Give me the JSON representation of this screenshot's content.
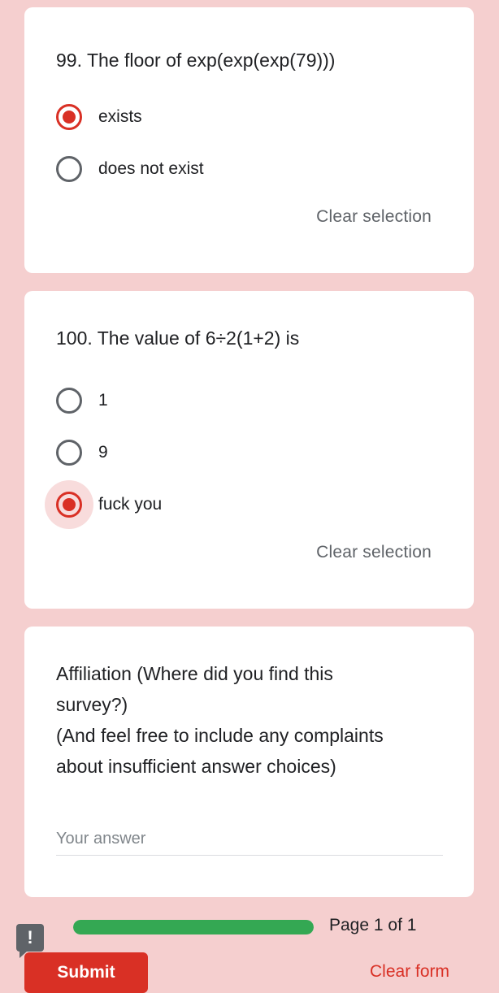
{
  "questions": [
    {
      "title": "99.  The floor of exp(exp(exp(79)))",
      "options": [
        {
          "label": "exists",
          "selected": true
        },
        {
          "label": "does not exist",
          "selected": false
        }
      ],
      "clear_label": "Clear selection"
    },
    {
      "title": "100.  The value of 6÷2(1+2) is",
      "options": [
        {
          "label": "1",
          "selected": false
        },
        {
          "label": "9",
          "selected": false
        },
        {
          "label": "fuck you",
          "selected": true
        }
      ],
      "clear_label": "Clear selection"
    }
  ],
  "affiliation": {
    "title_line1": "Affiliation (Where did you find this",
    "title_line2": "survey?)",
    "title_line3": "(And feel free to include any complaints",
    "title_line4": "about insufficient answer choices)",
    "placeholder": "Your answer",
    "value": ""
  },
  "footer": {
    "feedback_icon": "!",
    "progress_fraction": 1.0,
    "page_text": "Page 1 of 1",
    "submit_label": "Submit",
    "clear_form_label": "Clear form"
  },
  "colors": {
    "background": "#f5cfcf",
    "accent": "#d93025",
    "progress": "#34a853"
  }
}
